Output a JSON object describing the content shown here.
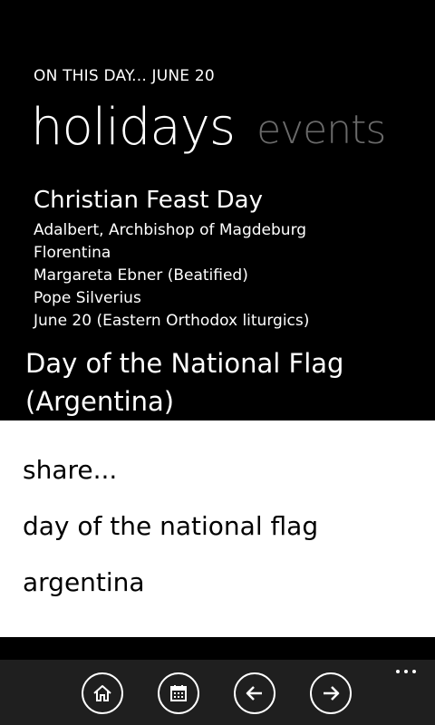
{
  "header": {
    "app_title": "ON THIS DAY... JUNE 20"
  },
  "pivot": {
    "items": [
      {
        "label": "holidays",
        "active": true
      },
      {
        "label": "events",
        "active": false
      }
    ]
  },
  "content": {
    "section_title": "Christian Feast Day",
    "feast_items": [
      "Adalbert, Archbishop of Magdeburg",
      "Florentina",
      "Margareta Ebner (Beatified)",
      "Pope Silverius",
      "June 20 (Eastern Orthodox liturgics)"
    ],
    "highlighted_holiday": "Day of the National Flag (Argentina)"
  },
  "context_menu": {
    "items": [
      "share...",
      "day of the national flag",
      "argentina"
    ]
  },
  "app_bar": {
    "buttons": [
      {
        "icon": "home-icon"
      },
      {
        "icon": "calendar-icon"
      },
      {
        "icon": "arrow-left-icon"
      },
      {
        "icon": "arrow-right-icon"
      }
    ],
    "more_icon": "ellipsis-icon"
  },
  "colors": {
    "background": "#000000",
    "inactive_pivot": "#6a6a6a",
    "menu_background": "#ffffff",
    "app_bar": "#1f1f1f"
  }
}
